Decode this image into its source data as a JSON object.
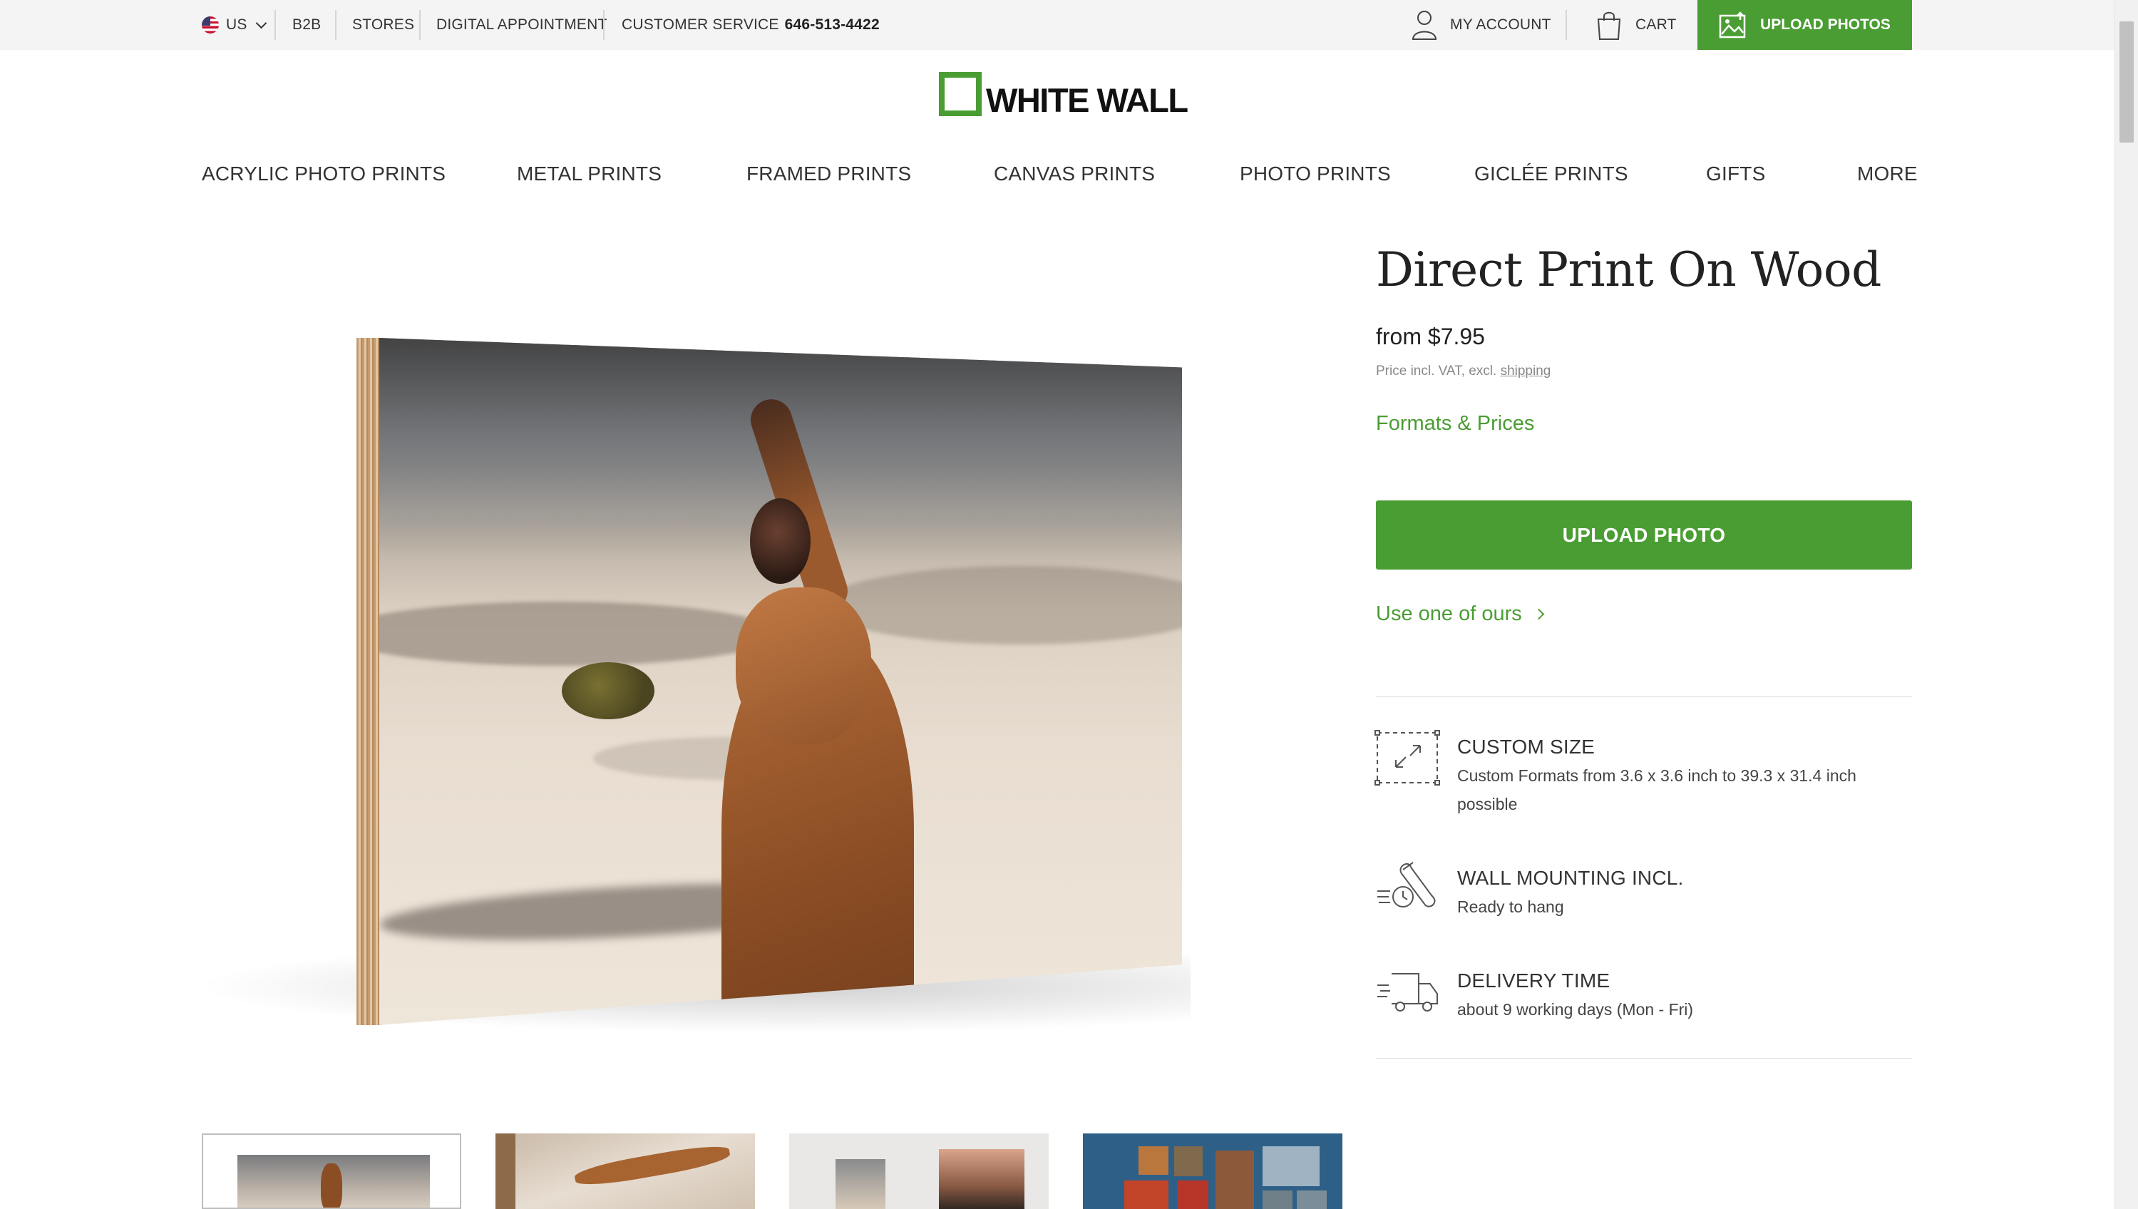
{
  "topbar": {
    "country": "US",
    "b2b": "B2B",
    "stores": "STORES",
    "digital_appointment": "DIGITAL APPOINTMENT",
    "customer_service_label": "CUSTOMER SERVICE",
    "customer_service_phone": "646-513-4422",
    "my_account": "MY ACCOUNT",
    "cart": "CART",
    "upload_photos": "UPLOAD PHOTOS"
  },
  "logo": {
    "text": "WHITE WALL"
  },
  "nav": {
    "items": [
      "ACRYLIC PHOTO PRINTS",
      "METAL PRINTS",
      "FRAMED PRINTS",
      "CANVAS PRINTS",
      "PHOTO PRINTS",
      "GICLÉE PRINTS",
      "GIFTS",
      "MORE"
    ]
  },
  "product": {
    "title": "Direct Print On Wood",
    "price": "from $7.95",
    "price_note": "Price incl. VAT, excl.",
    "shipping_link": "shipping",
    "formats_link": "Formats & Prices",
    "upload_button": "UPLOAD PHOTO",
    "use_ours": "Use one of ours"
  },
  "features": [
    {
      "icon": "resize-arrows-icon",
      "title": "CUSTOM SIZE",
      "desc": "Custom Formats from 3.6 x 3.6 inch to 39.3 x 31.4 inch possible"
    },
    {
      "icon": "wall-mount-tools-icon",
      "title": "WALL MOUNTING INCL.",
      "desc": "Ready to hang"
    },
    {
      "icon": "delivery-truck-icon",
      "title": "DELIVERY TIME",
      "desc": "about 9 working days (Mon - Fri)"
    }
  ],
  "colors": {
    "brand_green": "#4a9d33",
    "topbar_bg": "#f4f4f4"
  }
}
